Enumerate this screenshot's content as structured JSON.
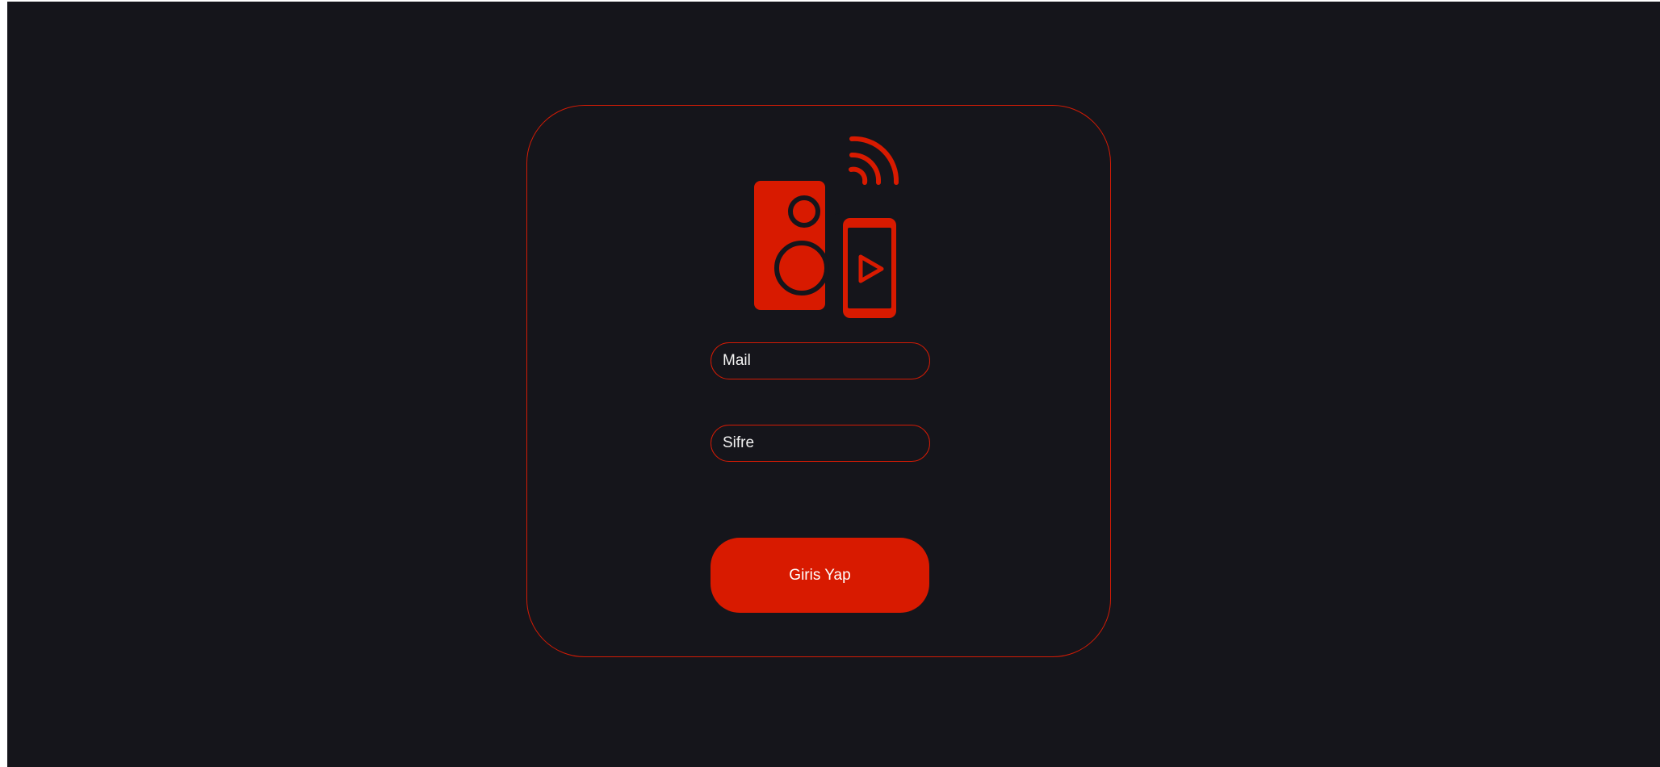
{
  "colors": {
    "background": "#15151b",
    "accent": "#d81a00",
    "border": "#d21b05",
    "text": "#f2f2f2"
  },
  "logo": {
    "icon": "speaker-phone-wifi-icon"
  },
  "form": {
    "mail_placeholder": "Mail",
    "password_placeholder": "Sifre",
    "submit_label": "Giris Yap"
  }
}
